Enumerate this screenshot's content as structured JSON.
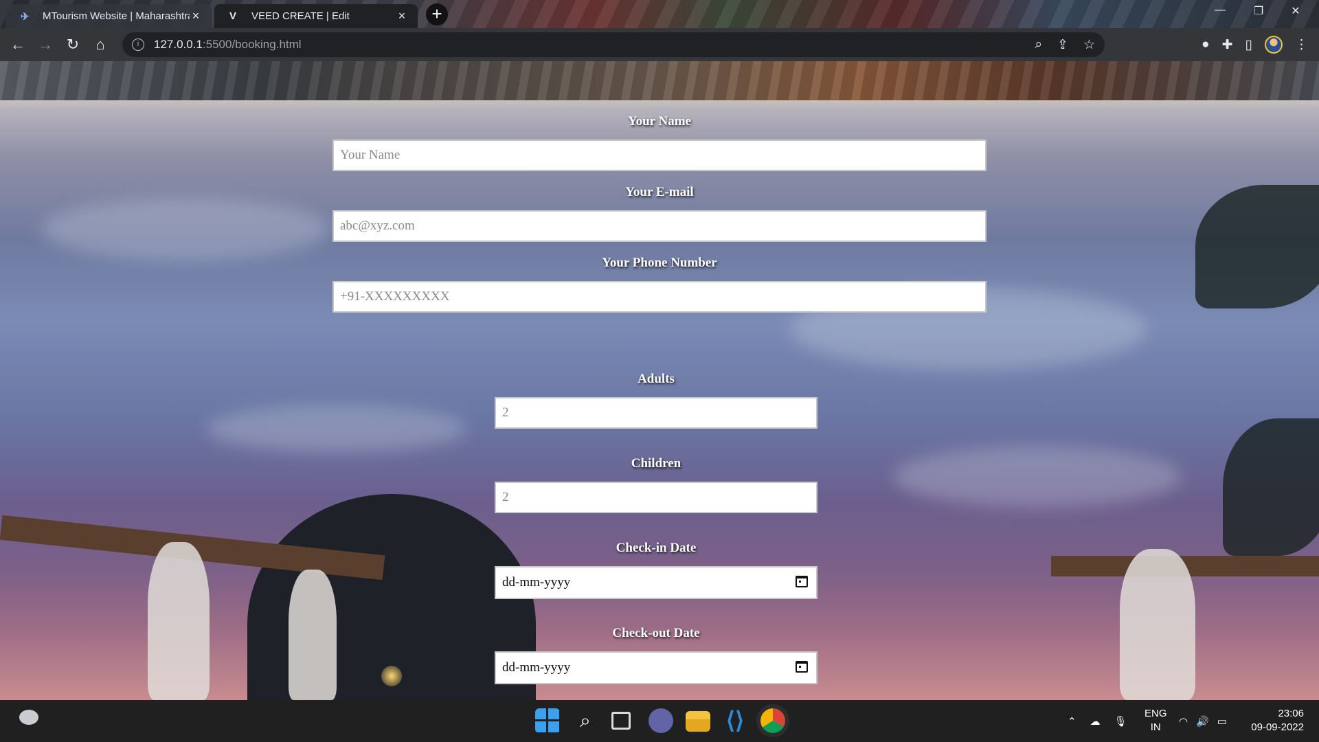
{
  "browser": {
    "tabs": [
      {
        "label": "MTourism Website | Maharashtra",
        "favicon": "airplane-icon",
        "active": false
      },
      {
        "label": "VEED CREATE | Edit",
        "favicon": "V",
        "active": true
      }
    ],
    "url_host": "127.0.0.1",
    "url_path": ":5500/booking.html"
  },
  "form": {
    "name_label": "Your Name",
    "name_placeholder": "Your Name",
    "email_label": "Your E-mail",
    "email_placeholder": "abc@xyz.com",
    "phone_label": "Your Phone Number",
    "phone_placeholder": "+91-XXXXXXXXX",
    "adults_label": "Adults",
    "adults_placeholder": "2",
    "children_label": "Children",
    "children_placeholder": "2",
    "checkin_label": "Check-in Date",
    "checkin_value": "dd-mm-yyyy",
    "checkout_label": "Check-out Date",
    "checkout_value": "dd-mm-yyyy"
  },
  "taskbar": {
    "lang_line1": "ENG",
    "lang_line2": "IN",
    "time": "23:06",
    "date": "09-09-2022"
  },
  "colors": {
    "label_text": "#ffffff",
    "input_bg": "#ffffff",
    "placeholder": "#8a8a8a",
    "taskbar_bg": "#202020",
    "toolbar_bg": "#35363a"
  }
}
